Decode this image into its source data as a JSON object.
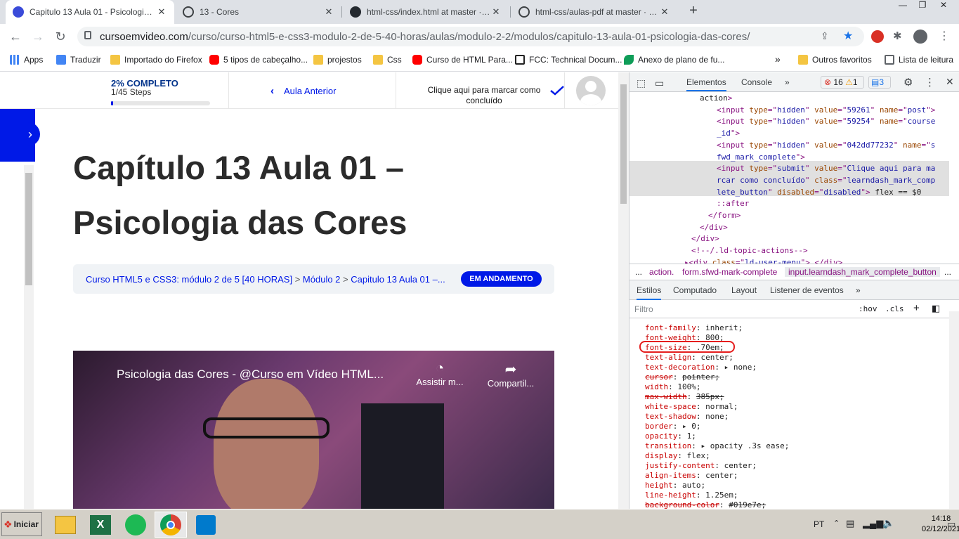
{
  "browser": {
    "tabs": [
      {
        "title": "Capitulo 13 Aula 01 - Psicologia das C",
        "icon": "cursoemvideo-favicon",
        "active": true
      },
      {
        "title": "13 - Cores",
        "icon": "globe-icon",
        "active": false
      },
      {
        "title": "html-css/index.html at master · gust",
        "icon": "github-icon",
        "active": false
      },
      {
        "title": "html-css/aulas-pdf at master · gusta",
        "icon": "globe-icon",
        "active": false
      }
    ],
    "new_tab": "+",
    "url_domain": "cursoemvideo.com",
    "url_path": "/curso/curso-html5-e-css3-modulo-2-de-5-40-horas/aulas/modulo-2-2/modulos/capitulo-13-aula-01-psicologia-das-cores/",
    "bookmarks": [
      {
        "label": "Apps",
        "icon": "apps-grid-icon"
      },
      {
        "label": "Traduzir",
        "icon": "google-translate-icon"
      },
      {
        "label": "Importado do Firefox",
        "icon": "folder-icon"
      },
      {
        "label": "5 tipos de cabeçalho...",
        "icon": "youtube-icon"
      },
      {
        "label": "projestos",
        "icon": "folder-icon"
      },
      {
        "label": "Css",
        "icon": "folder-icon"
      },
      {
        "label": "Curso de HTML Para...",
        "icon": "youtube-icon"
      },
      {
        "label": "FCC: Technical Docum...",
        "icon": "freecodecamp-icon"
      },
      {
        "label": "Anexo de plano de fu...",
        "icon": "leaf-icon"
      }
    ],
    "bookmarks_more": "»",
    "other_favorites": "Outros favoritos",
    "reading_list": "Lista de leitura",
    "colors": {
      "accent": "#0019e7",
      "tabbar": "#dee1e6"
    }
  },
  "lesson": {
    "progress_percent_label": "2% COMPLETO",
    "progress_fraction": 0.02,
    "steps_label": "1/45 Steps",
    "prev_label": "Aula Anterior",
    "mark_complete_label": "Clique aqui para marcar como concluído",
    "title": "Capítulo 13 Aula 01 – Psicologia das Cores",
    "breadcrumb": [
      "Curso HTML5 e CSS3: módulo 2 de 5 [40 HORAS]",
      "Módulo 2",
      "Capitulo 13 Aula 01 –..."
    ],
    "breadcrumb_sep": ">",
    "status_badge": "EM ANDAMENTO",
    "video": {
      "title": "Psicologia das Cores - @Curso em Vídeo HTML...",
      "watch_later": "Assistir m...",
      "share": "Compartil..."
    }
  },
  "devtools": {
    "tabs": [
      "Elementos",
      "Console",
      "»"
    ],
    "errors": "16",
    "warnings": "1",
    "messages": "3",
    "dom_lines": [
      {
        "parts": [
          [
            "tx",
            "action"
          ],
          [
            "tag",
            ">"
          ]
        ]
      },
      {
        "parts": [
          [
            "tag",
            "<input "
          ],
          [
            "an",
            "type"
          ],
          [
            "tag",
            "=\""
          ],
          [
            "av",
            "hidden"
          ],
          [
            "tag",
            "\" "
          ],
          [
            "an",
            "value"
          ],
          [
            "tag",
            "=\""
          ],
          [
            "av",
            "59261"
          ],
          [
            "tag",
            "\" "
          ],
          [
            "an",
            "name"
          ],
          [
            "tag",
            "=\""
          ],
          [
            "av",
            "post"
          ],
          [
            "tag",
            "\">"
          ]
        ]
      },
      {
        "parts": [
          [
            "tag",
            "<input "
          ],
          [
            "an",
            "type"
          ],
          [
            "tag",
            "=\""
          ],
          [
            "av",
            "hidden"
          ],
          [
            "tag",
            "\" "
          ],
          [
            "an",
            "value"
          ],
          [
            "tag",
            "=\""
          ],
          [
            "av",
            "59254"
          ],
          [
            "tag",
            "\" "
          ],
          [
            "an",
            "name"
          ],
          [
            "tag",
            "=\""
          ],
          [
            "av",
            "course"
          ]
        ]
      },
      {
        "parts": [
          [
            "av",
            "_id"
          ],
          [
            "tag",
            "\">"
          ]
        ]
      },
      {
        "parts": [
          [
            "tag",
            "<input "
          ],
          [
            "an",
            "type"
          ],
          [
            "tag",
            "=\""
          ],
          [
            "av",
            "hidden"
          ],
          [
            "tag",
            "\" "
          ],
          [
            "an",
            "value"
          ],
          [
            "tag",
            "=\""
          ],
          [
            "av",
            "042dd77232"
          ],
          [
            "tag",
            "\" "
          ],
          [
            "an",
            "name"
          ],
          [
            "tag",
            "=\""
          ],
          [
            "av",
            "s"
          ]
        ]
      },
      {
        "parts": [
          [
            "av",
            "fwd_mark_complete"
          ],
          [
            "tag",
            "\">"
          ]
        ]
      },
      {
        "parts": [
          [
            "tag",
            "<input "
          ],
          [
            "an",
            "type"
          ],
          [
            "tag",
            "=\""
          ],
          [
            "av",
            "submit"
          ],
          [
            "tag",
            "\" "
          ],
          [
            "an",
            "value"
          ],
          [
            "tag",
            "=\""
          ],
          [
            "av",
            "Clique aqui para ma"
          ]
        ]
      },
      {
        "parts": [
          [
            "av",
            "rcar como concluído"
          ],
          [
            "tag",
            "\" "
          ],
          [
            "an",
            "class"
          ],
          [
            "tag",
            "=\""
          ],
          [
            "av",
            "learndash_mark_comp"
          ]
        ]
      },
      {
        "parts": [
          [
            "av",
            "lete_button"
          ],
          [
            "tag",
            "\" "
          ],
          [
            "an",
            "disabled"
          ],
          [
            "tag",
            "=\""
          ],
          [
            "av",
            "disabled"
          ],
          [
            "tag",
            "\"> "
          ],
          [
            "tx",
            "flex == $0"
          ]
        ]
      },
      {
        "parts": [
          [
            "tag",
            "::after"
          ]
        ]
      },
      {
        "parts": [
          [
            "tag",
            "</form>"
          ]
        ]
      },
      {
        "parts": [
          [
            "tag",
            "</div>"
          ]
        ]
      },
      {
        "parts": [
          [
            "tag",
            "</div>"
          ]
        ]
      },
      {
        "parts": [
          [
            "tag",
            "<!--/.ld-topic-actions-->"
          ]
        ]
      },
      {
        "parts": [
          [
            "tag",
            "▸<div "
          ],
          [
            "an",
            "class"
          ],
          [
            "tag",
            "=\""
          ],
          [
            "av",
            "ld-user-menu"
          ],
          [
            "tag",
            "\">…</div>"
          ]
        ]
      }
    ],
    "crumbs": [
      "...",
      "action.",
      "form.sfwd-mark-complete",
      "input.learndash_mark_complete_button",
      "..."
    ],
    "styles_tabs": [
      "Estilos",
      "Computado",
      "Layout",
      "Listener de eventos",
      "»"
    ],
    "filter_placeholder": "Filtro",
    "filter_hov": ":hov",
    "filter_cls": ".cls",
    "styles": [
      {
        "prop": "font-family",
        "value": "inherit;",
        "strike": false
      },
      {
        "prop": "font-weight",
        "value": "800;",
        "strike": false
      },
      {
        "prop": "font-size",
        "value": ".70em;",
        "strike": false
      },
      {
        "prop": "text-align",
        "value": "center;",
        "strike": false
      },
      {
        "prop": "text-decoration",
        "value": "▸ none;",
        "strike": false
      },
      {
        "prop": "cursor",
        "value": "pointer;",
        "strike": true
      },
      {
        "prop": "width",
        "value": "100%;",
        "strike": false
      },
      {
        "prop": "max-width",
        "value": "385px;",
        "strike": true
      },
      {
        "prop": "white-space",
        "value": "normal;",
        "strike": false
      },
      {
        "prop": "text-shadow",
        "value": "none;",
        "strike": false
      },
      {
        "prop": "border",
        "value": "▸ 0;",
        "strike": false
      },
      {
        "prop": "opacity",
        "value": "1;",
        "strike": false
      },
      {
        "prop": "transition",
        "value": "▸ opacity .3s ease;",
        "strike": false
      },
      {
        "prop": "display",
        "value": "flex;",
        "strike": false
      },
      {
        "prop": "justify-content",
        "value": "center;",
        "strike": false
      },
      {
        "prop": "align-items",
        "value": "center;",
        "strike": false
      },
      {
        "prop": "height",
        "value": "auto;",
        "strike": false
      },
      {
        "prop": "line-height",
        "value": "1.25em;",
        "strike": false
      },
      {
        "prop": "background-color",
        "value": "#019e7e;",
        "strike": true
      }
    ]
  },
  "taskbar": {
    "start": "Iniciar",
    "apps": [
      "file-explorer-icon",
      "excel-icon",
      "spotify-icon",
      "chrome-icon",
      "vscode-icon"
    ],
    "lang": "PT",
    "time": "14:18",
    "date": "02/12/2021"
  }
}
